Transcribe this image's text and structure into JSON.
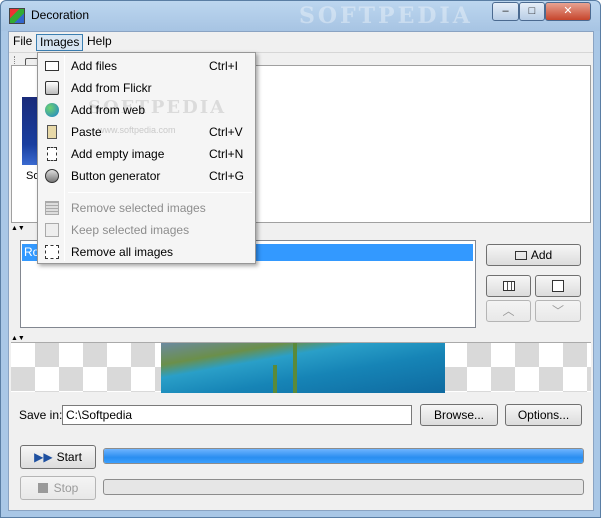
{
  "window": {
    "title": "Decoration",
    "watermark": "SOFTPEDIA",
    "controls": {
      "minimize": "–",
      "maximize": "□",
      "close": "✕"
    }
  },
  "menubar": {
    "items": [
      {
        "label": "File"
      },
      {
        "label": "Images",
        "active": true
      },
      {
        "label": "Help"
      }
    ]
  },
  "images_menu": {
    "watermark": "SOFTPEDIA",
    "watermark_sub": "www.softpedia.com",
    "items": [
      {
        "label": "Add files",
        "shortcut": "Ctrl+I",
        "icon": "add-files-icon",
        "enabled": true
      },
      {
        "label": "Add from Flickr",
        "shortcut": "",
        "icon": "flickr-icon",
        "enabled": true
      },
      {
        "label": "Add from web",
        "shortcut": "",
        "icon": "globe-icon",
        "enabled": true
      },
      {
        "label": "Paste",
        "shortcut": "Ctrl+V",
        "icon": "paste-icon",
        "enabled": true
      },
      {
        "label": "Add empty image",
        "shortcut": "Ctrl+N",
        "icon": "new-image-icon",
        "enabled": true
      },
      {
        "label": "Button generator",
        "shortcut": "Ctrl+G",
        "icon": "button-generator-icon",
        "enabled": true
      },
      {
        "label": "Remove selected images",
        "shortcut": "",
        "icon": "remove-selected-icon",
        "enabled": false
      },
      {
        "label": "Keep selected images",
        "shortcut": "",
        "icon": "keep-selected-icon",
        "enabled": false
      },
      {
        "label": "Remove all images",
        "shortcut": "",
        "icon": "remove-all-icon",
        "enabled": true
      }
    ]
  },
  "thumbnails": {
    "items": [
      {
        "label": "So"
      }
    ]
  },
  "operations_list": {
    "rows": [
      {
        "label": "Ro"
      }
    ]
  },
  "side_buttons": {
    "add_label": "Add",
    "add_icon": "add-list-icon",
    "edit_icon": "pencil-icon",
    "settings_icon": "grid-icon",
    "up_icon": "chevron-up-icon",
    "down_icon": "chevron-down-icon"
  },
  "save": {
    "label": "Save in:",
    "path": "C:\\Softpedia",
    "browse_label": "Browse...",
    "options_label": "Options..."
  },
  "run": {
    "start_label": "Start",
    "stop_label": "Stop",
    "start_progress": 1.0,
    "stop_progress": 0.0
  },
  "colors": {
    "selection": "#3399ff",
    "progress": "#2a8ef0",
    "title_gradient": "#a7c4e3"
  }
}
